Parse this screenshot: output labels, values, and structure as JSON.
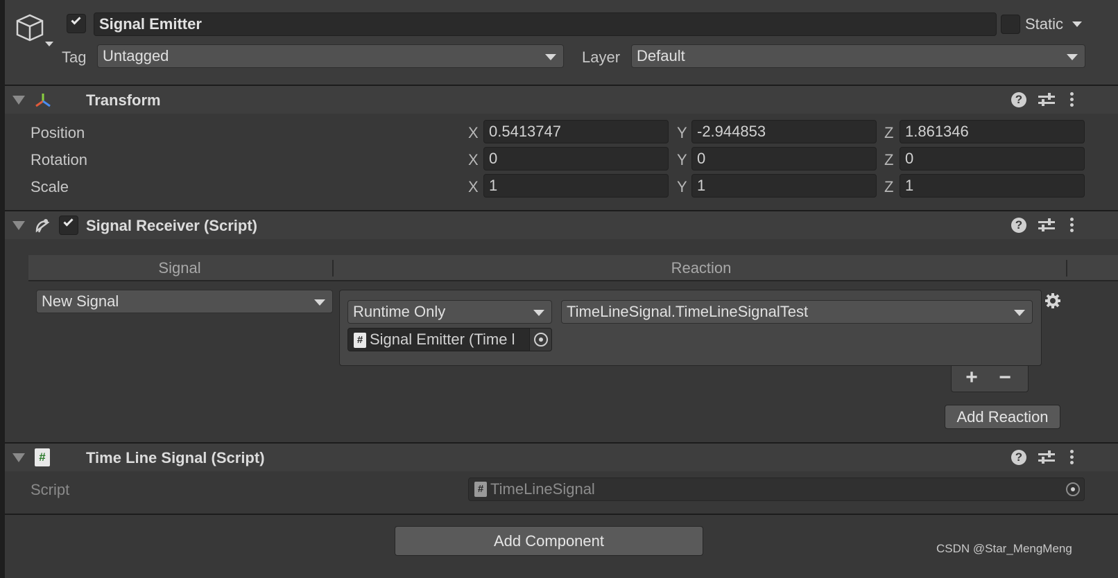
{
  "gameobject": {
    "name": "Signal Emitter",
    "active": true,
    "static_label": "Static",
    "tag_label": "Tag",
    "tag_value": "Untagged",
    "layer_label": "Layer",
    "layer_value": "Default"
  },
  "transform": {
    "title": "Transform",
    "rows": [
      {
        "label": "Position",
        "x": "0.5413747",
        "y": "-2.944853",
        "z": "1.861346"
      },
      {
        "label": "Rotation",
        "x": "0",
        "y": "0",
        "z": "0"
      },
      {
        "label": "Scale",
        "x": "1",
        "y": "1",
        "z": "1"
      }
    ],
    "axes": {
      "x": "X",
      "y": "Y",
      "z": "Z"
    }
  },
  "signal_receiver": {
    "title": "Signal Receiver (Script)",
    "enabled": true,
    "col_signal": "Signal",
    "col_reaction": "Reaction",
    "signal_value": "New Signal",
    "runtime_value": "Runtime Only",
    "function_value": "TimeLineSignal.TimeLineSignalTest",
    "object_value": "Signal Emitter (Time l",
    "plus": "+",
    "minus": "−",
    "add_reaction": "Add Reaction"
  },
  "timeline_signal": {
    "title": "Time Line Signal (Script)",
    "script_label": "Script",
    "script_value": "TimeLineSignal"
  },
  "add_component": "Add Component",
  "watermark": "CSDN @Star_MengMeng",
  "icons": {
    "header_help": "help-icon",
    "header_presets": "presets-icon",
    "header_menu": "kebab-menu-icon"
  },
  "colors": {
    "panel": "#383838",
    "header": "#3e3e3e",
    "field": "#2a2a2a",
    "dropdown": "#515151"
  }
}
